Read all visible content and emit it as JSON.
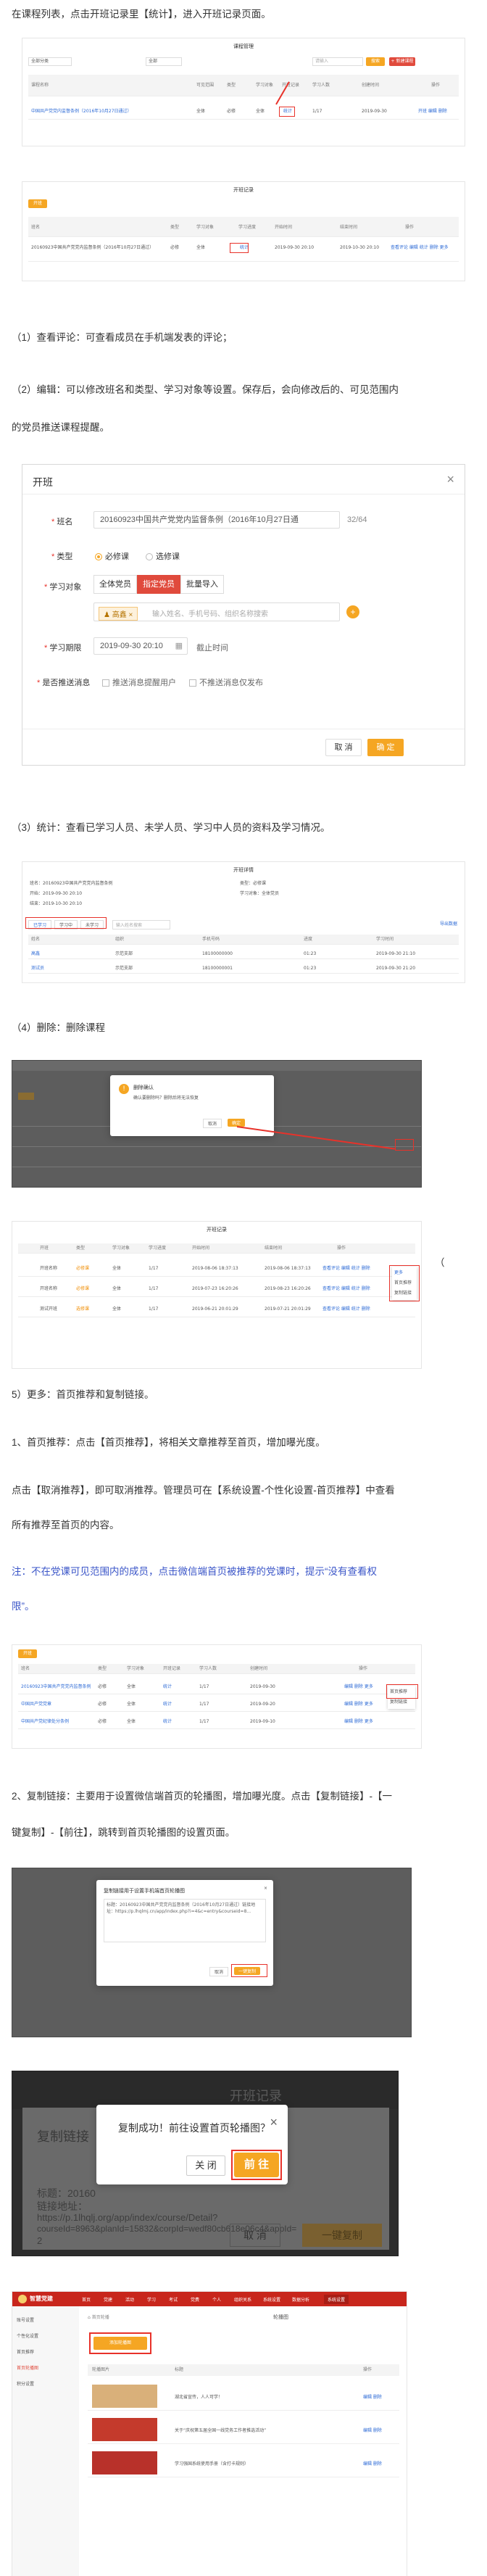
{
  "paragraphs": {
    "p_intro": "在课程列表，点击开班记录里【统计】，进入开班记录页面。",
    "p_view": "（1）查看评论：可查看成员在手机端发表的评论；",
    "p_edit_1": "（2）编辑：可以修改班名和类型、学习对象等设置。保存后，会向修改后的、可见范围内",
    "p_edit_2": "的党员推送课程提醒。",
    "p_stats": "（3）统计：查看已学习人员、未学人员、学习中人员的资料及学习情况。",
    "p_delete": "（4）删除：删除课程",
    "p_more": "5）更多：首页推荐和复制链接。",
    "p_rec_1": "1、首页推荐：点击【首页推荐】，将相关文章推荐至首页，增加曝光度。",
    "p_cancel_1": "点击【取消推荐】，即可取消推荐。管理员可在【系统设置-个性化设置-首页推荐】中查看",
    "p_cancel_2": "所有推荐至首页的内容。",
    "p_note_1": "注：不在党课可见范围内的成员，点击微信端首页被推荐的党课时，提示“没有查看权",
    "p_note_2": "限”。",
    "p_copy_1": "2、复制链接：主要用于设置微信端首页的轮播图，增加曝光度。点击【复制链接】-【一",
    "p_copy_2": "键复制】-【前往】，跳转到首页轮播图的设置页面。",
    "open_paren": "（"
  },
  "shot1": {
    "title": "课程管理",
    "filter_label": "全部分类",
    "filter_select": "全部",
    "search_placeholder": "请输入",
    "search_btn": "搜索",
    "add_btn": "+ 新建课程",
    "headers": [
      "课程名称",
      "可见范围",
      "类型",
      "学习对象",
      "开班记录",
      "学习人数",
      "创建时间",
      "操作"
    ],
    "row": [
      "中国共产党党内监督条例（2016年10月27日通过）",
      "全体",
      "必修",
      "全体",
      "统计",
      "1/17",
      "2019-09-30",
      "开班 编辑 删除"
    ]
  },
  "shot2": {
    "title": "开班记录",
    "add_btn": "开班",
    "headers": [
      "班名",
      "类型",
      "学习对象",
      "学习进度",
      "开始时间",
      "结束时间",
      "操作"
    ],
    "row": [
      "20160923中国共产党党内监督条例（2016年10月27日通过）",
      "必修",
      "全体",
      "统计",
      "2019-09-30 20:10",
      "2019-10-30 20:10",
      "查看评论 编辑 统计 删除 更多"
    ]
  },
  "dialog": {
    "title": "开班",
    "name_label": "班名",
    "name_value": "20160923中国共产党党内监督条例（2016年10月27日通",
    "name_count": "32/64",
    "type_label": "类型",
    "type_opt1": "必修课",
    "type_opt2": "选修课",
    "target_label": "学习对象",
    "target_opt1": "全体党员",
    "target_opt2": "指定党员",
    "target_opt3": "批量导入",
    "person_tag": "高鑫",
    "person_placeholder": "输入姓名、手机号码、组织名称搜索",
    "date_label": "学习期限",
    "date_value": "2019-09-30 20:10",
    "date_extra": "截止时间",
    "push_label": "是否推送消息",
    "push_opt1": "推送消息提醒用户",
    "push_opt2": "不推送消息仅发布",
    "cancel": "取 消",
    "confirm": "确 定"
  },
  "shot3": {
    "title": "开班详情",
    "info": [
      "班名：20160923中国共产党党内监督条例",
      "开始：2019-09-30 20:10",
      "结束：2019-10-30 20:10",
      "类型：必修课",
      "学习对象：全体党员"
    ],
    "tabs": [
      "已学习",
      "学习中",
      "未学习"
    ],
    "search_placeholder": "输入姓名搜索",
    "export": "导出数据",
    "headers": [
      "姓名",
      "组织",
      "手机号码",
      "进度",
      "学习时间"
    ],
    "rows": [
      [
        "高鑫",
        "示范支部",
        "18100000000",
        "01:23",
        "2019-09-30 21:10"
      ],
      [
        "测试员",
        "示范支部",
        "18100000001",
        "01:23",
        "2019-09-30 21:20"
      ]
    ]
  },
  "shot4": {
    "confirm_title": "删除确认",
    "confirm_text": "确认要删除吗？删除后将无法恢复",
    "cancel": "取消",
    "ok": "确定"
  },
  "shot5": {
    "title": "开班记录",
    "headers": [
      "开班",
      "类型",
      "学习对象",
      "学习进度",
      "开始时间",
      "结束时间",
      "操作"
    ],
    "rows": [
      [
        "开班名称",
        "必修课",
        "全体",
        "1/17",
        "2019-08-06 18:37:13",
        "2019-08-06 18:37:13",
        "查看评论 编辑 统计 删除"
      ],
      [
        "开班名称",
        "必修课",
        "全体",
        "1/17",
        "2019-07-23 16:20:26",
        "2019-08-23 16:20:26",
        "查看评论 编辑 统计 删除"
      ],
      [
        "测试开班",
        "选修课",
        "全体",
        "1/17",
        "2019-06-21 20:01:29",
        "2019-07-21 20:01:29",
        "查看评论 编辑 统计 删除"
      ]
    ],
    "more_menu": [
      "更多",
      "首页推荐",
      "复制链接"
    ]
  },
  "shot6": {
    "add_btn": "开班",
    "headers": [
      "班名",
      "类型",
      "学习对象",
      "开班记录",
      "学习人数",
      "创建时间",
      "操作"
    ],
    "rows": [
      [
        "20160923中国共产党党内监督条例",
        "必修",
        "全体",
        "统计",
        "1/17",
        "2019-09-30",
        "编辑 删除 更多"
      ],
      [
        "中国共产党党章",
        "必修",
        "全体",
        "统计",
        "1/17",
        "2019-09-20",
        "编辑 删除 更多"
      ],
      [
        "中国共产党纪律处分条例",
        "必修",
        "全体",
        "统计",
        "1/17",
        "2019-09-10",
        "编辑 删除 更多"
      ]
    ],
    "menu": [
      "首页推荐",
      "复制链接"
    ]
  },
  "shot7": {
    "dialog_title": "复制链接用于设置手机端首页轮播图",
    "dialog_text": "标题：20160923中国共产党党内监督条例（2016年10月27日通过）链接地址：https://p.lhqlmj.cn/app/index.php?i=4&c=entry&courseid=8...",
    "cancel": "取消",
    "ok": "一键复制"
  },
  "shot8": {
    "bg_title": "开班记录",
    "bg_dialog_title": "复制链接",
    "bg_text_1": "标题：20160",
    "bg_text_2": "链接地址：",
    "bg_text_3": "https://p.1lhqlj.org/app/index/course/Detail?",
    "bg_text_4": "courseId=8963&planId=15832&corpId=wedf80cb618e06c4&appId=",
    "bg_text_5": "2",
    "bg_cancel": "取 消",
    "bg_ok": "一键复制",
    "fg_title": "复制成功！前往设置首页轮播图？",
    "fg_close": "×",
    "fg_cancel": "关 闭",
    "fg_ok": "前 往"
  },
  "shot9": {
    "logo": "智慧党建",
    "nav": [
      "首页",
      "党建",
      "活动",
      "学习",
      "考试",
      "党费",
      "个人",
      "组织关系",
      "系统设置",
      "数据分析",
      "系统设置"
    ],
    "side": [
      "账号设置",
      "个性化设置",
      "首页推荐",
      "首页轮播图",
      "积分设置"
    ],
    "crumb": "首页轮播",
    "panel_title": "轮播图",
    "add_btn": "添加轮播图",
    "headers": [
      "轮播图片",
      "标题",
      "操作"
    ],
    "rows": [
      [
        "",
        "湖北省宣传，人人可学！",
        "编辑 删除"
      ],
      [
        "",
        "关于“庆祝第五届全国一线党务工作者推选活动”",
        "编辑 删除"
      ],
      [
        "",
        "学习强国系统使用手册（含打卡规则）",
        "编辑 删除"
      ]
    ]
  },
  "colors": {
    "accent": "#f5a623",
    "red": "#e8322a",
    "link": "#2e6bd6",
    "note": "#3a55c8"
  }
}
